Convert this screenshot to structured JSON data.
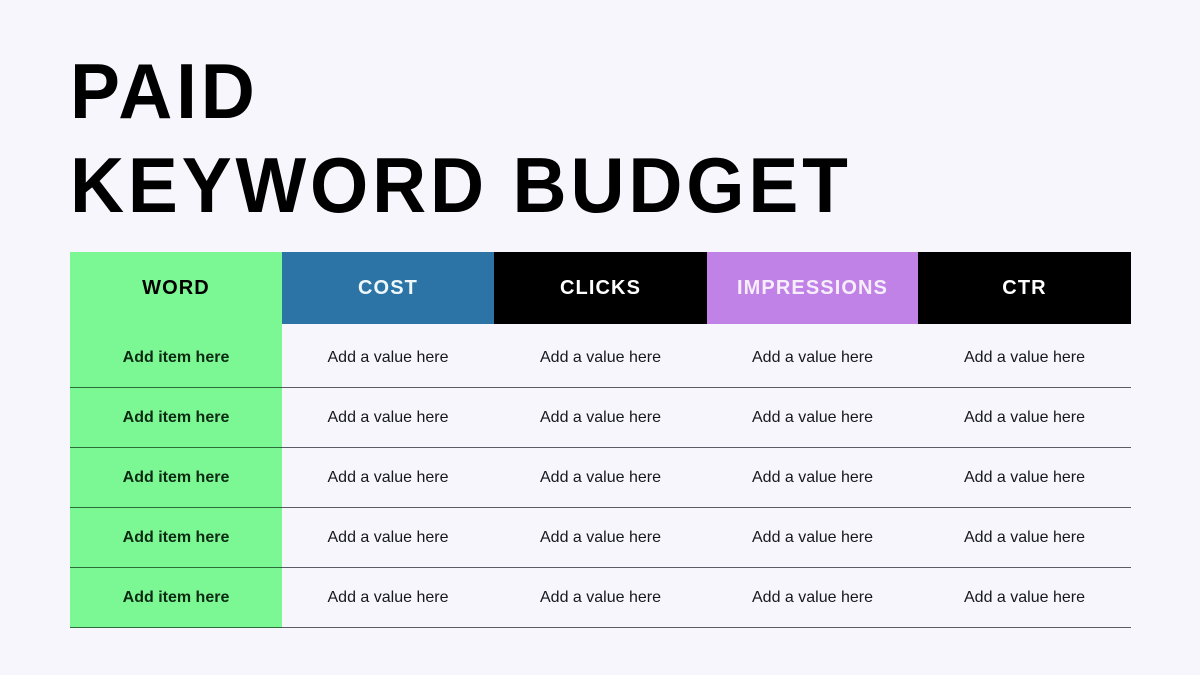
{
  "slide": {
    "background_color": "#f7f6fc",
    "title_lines": [
      "PAID",
      "KEYWORD BUDGET"
    ]
  },
  "colors": {
    "green": "#7bf794",
    "blue": "#2d74a6",
    "black": "#000000",
    "purple": "#c182e8",
    "background": "#f7f6fc",
    "body_text": "#17171f"
  },
  "table": {
    "headers": [
      {
        "label": "WORD",
        "bg": "#7bf794",
        "fg": "#000000"
      },
      {
        "label": "COST",
        "bg": "#2d74a6",
        "fg": "#eef7fb"
      },
      {
        "label": "CLICKS",
        "bg": "#000000",
        "fg": "#ffffff"
      },
      {
        "label": "IMPRESSIONS",
        "bg": "#c182e8",
        "fg": "#f6eefb"
      },
      {
        "label": "CTR",
        "bg": "#000000",
        "fg": "#ffffff"
      }
    ],
    "rows": [
      {
        "word": "Add item here",
        "cost": "Add a value here",
        "clicks": "Add a value here",
        "impressions": "Add a value here",
        "ctr": "Add a value here"
      },
      {
        "word": "Add item here",
        "cost": "Add a value here",
        "clicks": "Add a value here",
        "impressions": "Add a value here",
        "ctr": "Add a value here"
      },
      {
        "word": "Add item here",
        "cost": "Add a value here",
        "clicks": "Add a value here",
        "impressions": "Add a value here",
        "ctr": "Add a value here"
      },
      {
        "word": "Add item here",
        "cost": "Add a value here",
        "clicks": "Add a value here",
        "impressions": "Add a value here",
        "ctr": "Add a value here"
      },
      {
        "word": "Add item here",
        "cost": "Add a value here",
        "clicks": "Add a value here",
        "impressions": "Add a value here",
        "ctr": "Add a value here"
      }
    ]
  }
}
